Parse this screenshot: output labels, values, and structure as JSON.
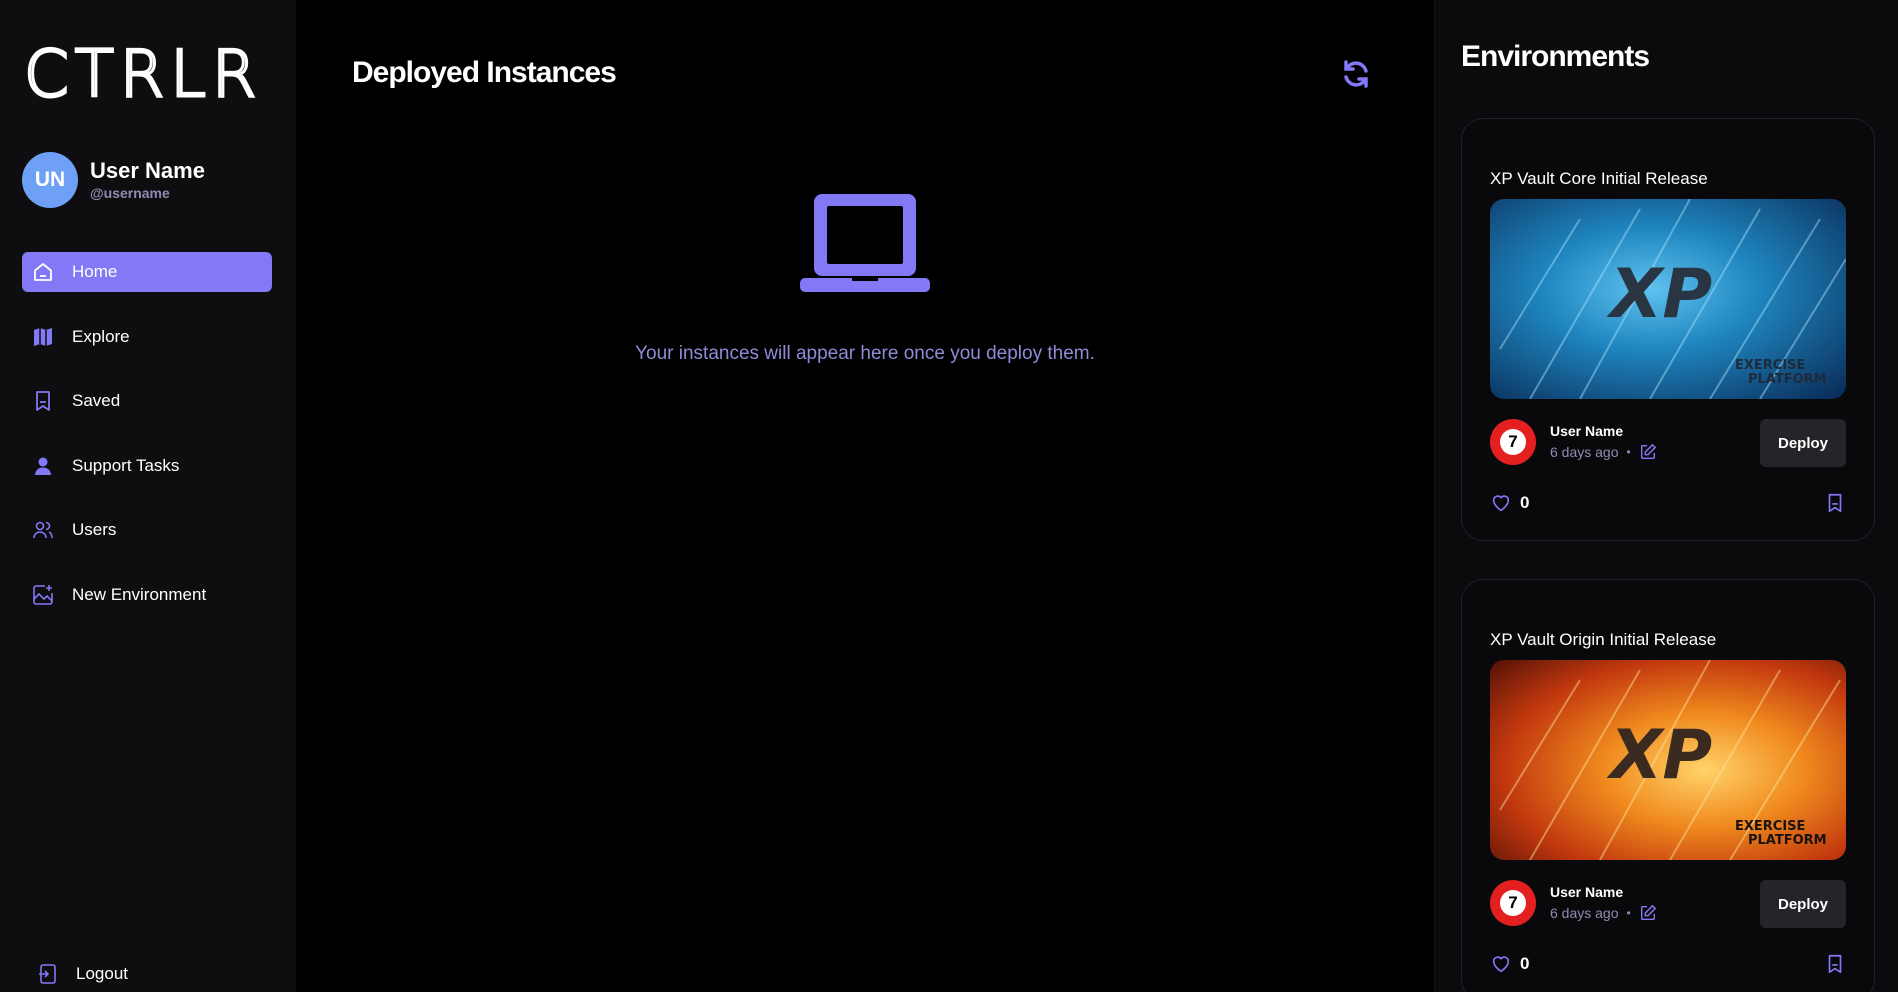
{
  "app": {
    "logo_text": "CTRLR"
  },
  "colors": {
    "accent": "#8378f5",
    "avatar": "#6ea0f5",
    "muted": "#8f8bb3",
    "badge": "#e41f1f"
  },
  "user": {
    "initials": "UN",
    "name": "User Name",
    "handle": "@username"
  },
  "nav": {
    "items": [
      {
        "label": "Home",
        "icon": "home-icon",
        "active": true
      },
      {
        "label": "Explore",
        "icon": "map-icon"
      },
      {
        "label": "Saved",
        "icon": "bookmark-icon"
      },
      {
        "label": "Support Tasks",
        "icon": "support-agent-icon"
      },
      {
        "label": "Users",
        "icon": "users-icon"
      },
      {
        "label": "New Environment",
        "icon": "new-image-icon"
      }
    ],
    "logout_label": "Logout"
  },
  "main": {
    "title": "Deployed Instances",
    "empty_message": "Your instances will appear here once you deploy them."
  },
  "environments": {
    "title": "Environments",
    "cards": [
      {
        "title": "XP Vault Core Initial Release",
        "image_theme": "blue",
        "image_brand": "XP",
        "image_tagline_1": "EXERCISE",
        "image_tagline_2": "PLATFORM",
        "author": "User Name",
        "badge": "7",
        "time": "6 days ago",
        "deploy_label": "Deploy",
        "likes": "0"
      },
      {
        "title": "XP Vault Origin Initial Release",
        "image_theme": "orange",
        "image_brand": "XP",
        "image_tagline_1": "EXERCISE",
        "image_tagline_2": "PLATFORM",
        "author": "User Name",
        "badge": "7",
        "time": "6 days ago",
        "deploy_label": "Deploy",
        "likes": "0"
      }
    ]
  }
}
